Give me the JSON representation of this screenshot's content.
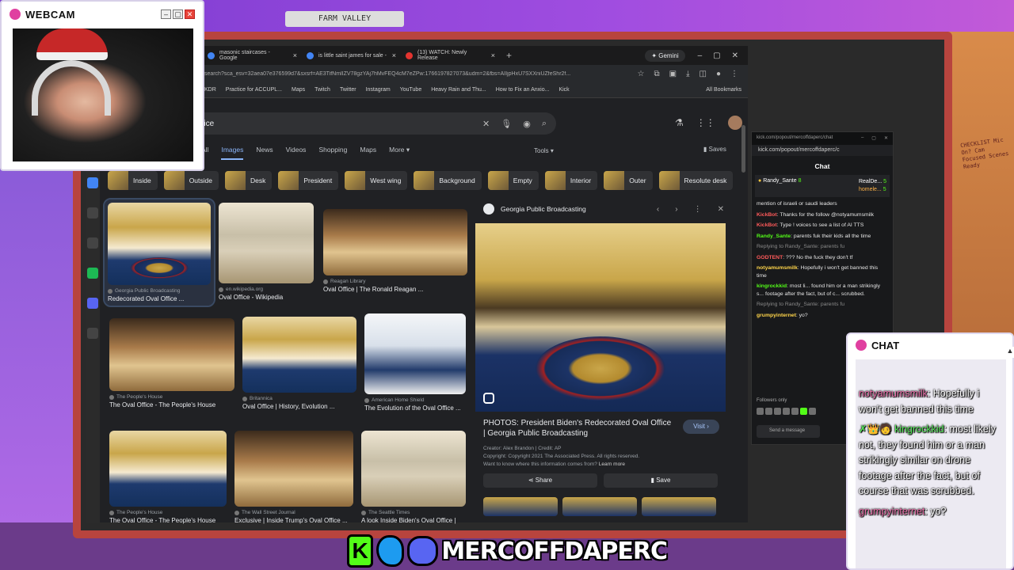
{
  "scene": {
    "top_sign": "FARM VALLEY",
    "sticky_note": "CHECKLIST Mic On? Cam Focused Scenes Ready"
  },
  "webcam": {
    "title": "WEBCAM",
    "min": "–",
    "max": "▢",
    "close": "✕"
  },
  "browser": {
    "tabs": [
      {
        "label": "masonic staircases - Google",
        "close": "×"
      },
      {
        "label": "is little saint james for sale -",
        "close": "×"
      },
      {
        "label": "(13) WATCH: Newly Release",
        "close": "×"
      }
    ],
    "newtab": "+",
    "gemini": "✦ Gemini",
    "window_controls": [
      "–",
      "▢",
      "✕"
    ],
    "url": "/search?sca_esv=32aea07e376599d7&sxsrf=AE3TifNmlIZV78gzYAj7hMvFEQ4cM7eZPw:1766197827073&udm=2&fbs=AIIjpHxU7SXXniUZfeShr2f...",
    "bookmarks": [
      "KDR",
      "Practice for ACCUPL...",
      "Maps",
      "Twitch",
      "Twitter",
      "Instagram",
      "YouTube",
      "Heavy Rain and Thu...",
      "How to Fix an Anxio...",
      "Kick"
    ],
    "all_bookmarks": "All Bookmarks"
  },
  "search": {
    "value": "ffice",
    "nav": [
      "All",
      "Images",
      "News",
      "Videos",
      "Shopping",
      "Maps",
      "More ▾"
    ],
    "active_nav": "Images",
    "tools": "Tools ▾",
    "saves": "Saves",
    "chips": [
      "Inside",
      "Outside",
      "Desk",
      "President",
      "West wing",
      "Background",
      "Empty",
      "Interior",
      "Outer",
      "Resolute desk"
    ]
  },
  "results": [
    {
      "source": "Georgia Public Broadcasting",
      "title": "Redecorated Oval Office ..."
    },
    {
      "source": "en.wikipedia.org",
      "title": "Oval Office - Wikipedia"
    },
    {
      "source": "Reagan Library",
      "title": "Oval Office | The Ronald Reagan ..."
    },
    {
      "source": "The People's House",
      "title": "The Oval Office - The People's House"
    },
    {
      "source": "Britannica",
      "title": "Oval Office | History, Evolution ..."
    },
    {
      "source": "American Home Shield",
      "title": "The Evolution of the Oval Office ..."
    },
    {
      "source": "The People's House",
      "title": "The Oval Office - The People's House"
    },
    {
      "source": "The Wall Street Journal",
      "title": "Exclusive | Inside Trump's Oval Office ..."
    },
    {
      "source": "The Seattle Times",
      "title": "A look Inside Biden's Oval Office |"
    }
  ],
  "preview": {
    "source": "Georgia Public Broadcasting",
    "title": "PHOTOS: President Biden's Redecorated Oval Office | Georgia Public Broadcasting",
    "visit": "Visit ›",
    "creator": "Creator: Alex Brandon | Credit: AP",
    "copyright": "Copyright: Copyright 2021 The Associated Press. All rights reserved.",
    "learn_prefix": "Want to know where this information comes from?",
    "learn_link": "Learn more",
    "share": "Share",
    "save": "Save"
  },
  "kick": {
    "tab_url": "kick.com/popout/mercoffdaperc/chat",
    "url": "kick.com/popout/mercoffdaperc/c",
    "title": "Chat",
    "pinned_user": "Randy_Sante",
    "pinned_count": "8",
    "pinned_users_right": [
      "RealDe...",
      "homele..."
    ],
    "pinned_right_counts": [
      "5",
      "5"
    ],
    "messages": [
      {
        "user": "",
        "text": "mention of israeli or saudi leaders",
        "cls": ""
      },
      {
        "user": "KickBot",
        "text": ": Thanks for the follow @notyamumsmilk",
        "cls": "u1"
      },
      {
        "user": "KickBot",
        "text": ": Type ! voices to see a list of AI TTS",
        "cls": "u1"
      },
      {
        "user": "Randy_Sante",
        "text": ": parents fuk their kids all the time",
        "cls": "u3"
      },
      {
        "user": "Replying to Randy_Sante: parents fu",
        "text": "",
        "cls": "rp"
      },
      {
        "user": "GODTENT",
        "text": ": ??? No the fuck they don't tf",
        "cls": "u1"
      },
      {
        "user": "notyamumsmilk",
        "text": ": Hopefully i won't get banned this time",
        "cls": "u2"
      },
      {
        "user": "kingrockkid",
        "text": ": most li... found him or a man strikingly s... footage after the fact, but of c... scrubbed.",
        "cls": "u3"
      },
      {
        "user": "Replying to Randy_Sante: parents fu",
        "text": "",
        "cls": "rp"
      },
      {
        "user": "grumpyinternet",
        "text": ": yo?",
        "cls": "u2"
      }
    ],
    "followers_only": "Followers only",
    "send": "Send a message"
  },
  "overlay_chat": {
    "title": "CHAT",
    "messages": [
      {
        "name": "notyamumsmilk",
        "text": ": Hopefully i won't get banned this time",
        "cls": "n1"
      },
      {
        "name": "✗👑🧑 kingrockkid",
        "text": ": most likely not, they found him or a man strikingly similar on drone footage after the fact, but of course that was scrubbed.",
        "cls": "n2"
      },
      {
        "name": "grumpyinternet",
        "text": ": yo?",
        "cls": "n3"
      }
    ]
  },
  "banner": {
    "k": "K",
    "name": "MERCOFFDAPERC"
  },
  "colors": {
    "kick_green": "#53fc18",
    "google_dark": "#202124",
    "frame_red": "#b8443e"
  }
}
